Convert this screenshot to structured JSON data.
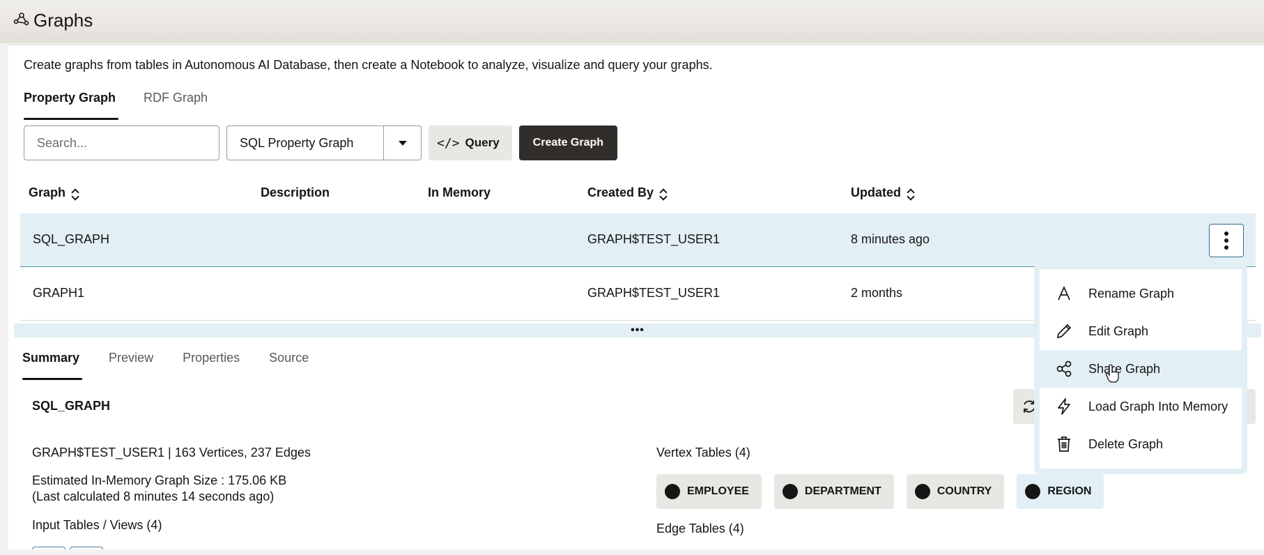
{
  "header": {
    "title": "Graphs",
    "logo_icon": "graph-logo-icon"
  },
  "description": "Create graphs from tables in Autonomous AI Database, then create a Notebook to analyze, visualize and query your graphs.",
  "top_tabs": [
    {
      "label": "Property Graph",
      "active": true
    },
    {
      "label": "RDF Graph",
      "active": false
    }
  ],
  "toolbar": {
    "search_placeholder": "Search...",
    "graph_type": "SQL Property Graph",
    "query_icon": "</>",
    "query_label": "Query",
    "create_label": "Create Graph"
  },
  "table": {
    "columns": [
      "Graph",
      "Description",
      "In Memory",
      "Created By",
      "Updated"
    ],
    "rows": [
      {
        "graph": "SQL_GRAPH",
        "description": "",
        "in_memory": "",
        "created_by": "GRAPH$TEST_USER1",
        "updated": "8 minutes ago"
      },
      {
        "graph": "GRAPH1",
        "description": "",
        "in_memory": "",
        "created_by": "GRAPH$TEST_USER1",
        "updated": "2 months"
      }
    ]
  },
  "splitter_label": "•••",
  "bottom_tabs": [
    {
      "label": "Summary",
      "active": true
    },
    {
      "label": "Preview",
      "active": false
    },
    {
      "label": "Properties",
      "active": false
    },
    {
      "label": "Source",
      "active": false
    }
  ],
  "summary": {
    "name": "SQL_GRAPH",
    "owner_line": "GRAPH$TEST_USER1 | 163 Vertices, 237 Edges",
    "size_line": "Estimated In-Memory Graph Size : 175.06 KB",
    "calc_line": "(Last calculated 8 minutes 14 seconds ago)",
    "input_tables": "Input Tables / Views (4)",
    "vertex_tables": "Vertex Tables (4)",
    "edge_tables": "Edge Tables (4)",
    "vertex_chips": [
      "EMPLOYEE",
      "DEPARTMENT",
      "COUNTRY",
      "REGION"
    ]
  },
  "context_menu": {
    "items": [
      {
        "label": "Rename Graph",
        "icon": "rename-icon"
      },
      {
        "label": "Edit Graph",
        "icon": "pencil-icon"
      },
      {
        "label": "Share Graph",
        "icon": "share-icon"
      },
      {
        "label": "Load Graph Into Memory",
        "icon": "lightning-icon"
      },
      {
        "label": "Delete Graph",
        "icon": "trash-icon"
      }
    ],
    "hovered": "Share Graph"
  },
  "colors": {
    "selected_row": "#e2eff5",
    "primary_button": "#312d2a",
    "secondary_button": "#e9e7e4"
  }
}
